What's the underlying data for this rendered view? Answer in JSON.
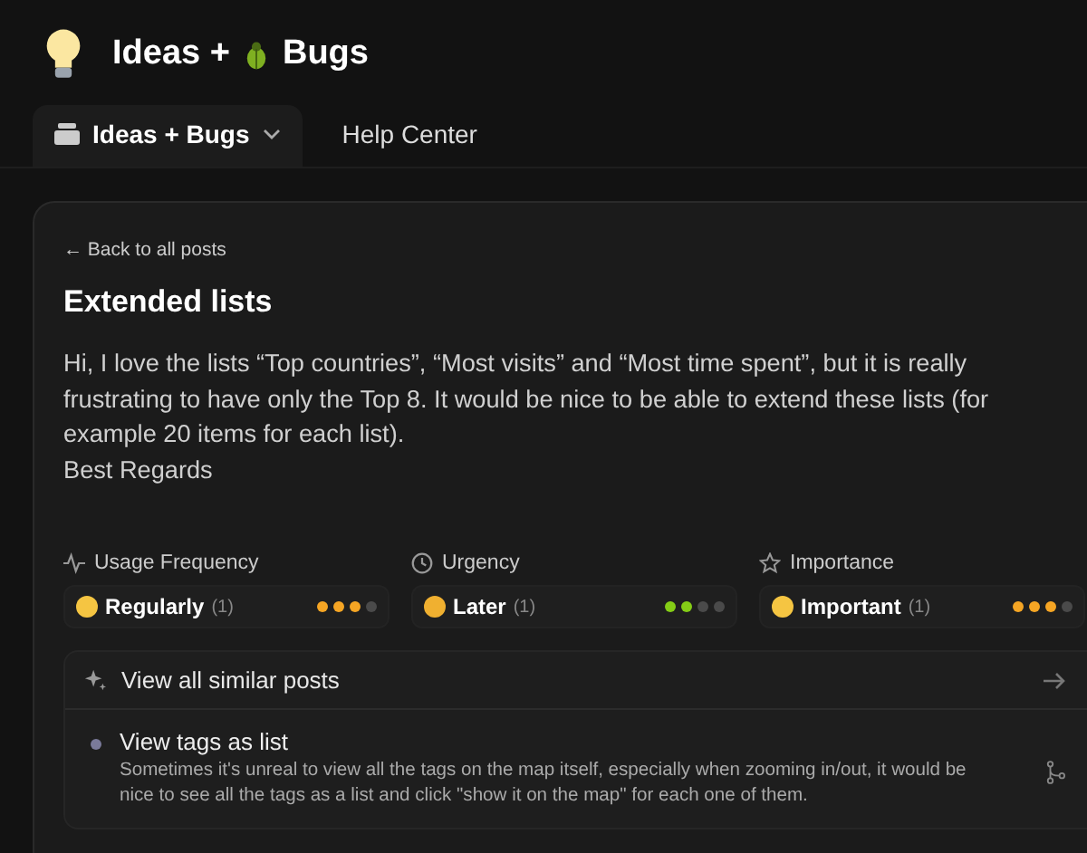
{
  "header": {
    "title_left": "Ideas +",
    "title_right": "Bugs"
  },
  "tabs": [
    {
      "label": "Ideas + Bugs",
      "selected": true,
      "dropdown": true
    },
    {
      "label": "Help Center",
      "selected": false,
      "dropdown": false
    }
  ],
  "post": {
    "back_link": "← Back to all posts",
    "title": "Extended lists",
    "body": [
      "Hi, I love the lists “Top countries”, “Most visits” and “Most time spent”, but it is really frustrating to have only the Top 8. It would be nice to be able to extend these lists (for example 20 items for each list).",
      "Best Regards"
    ]
  },
  "metrics": [
    {
      "kind": "frequency",
      "label": "Usage Frequency",
      "value": "Regularly",
      "count": "(1)",
      "level": 0.75,
      "color": "#f5a524"
    },
    {
      "kind": "urgency",
      "label": "Urgency",
      "value": "Later",
      "count": "(1)",
      "level": 0.5,
      "color": "#84cc16"
    },
    {
      "kind": "importance",
      "label": "Importance",
      "value": "Important",
      "count": "(1)",
      "level": 0.75,
      "color": "#f5a524"
    }
  ],
  "similar": {
    "title": "View all similar posts",
    "items": [
      {
        "title": "View tags as list",
        "description": "Sometimes it's unreal to view all the tags on the map itself, especially when zooming in/out, it would be nice to see all the tags as a list and click \"show it on the map\" for each one of them."
      }
    ]
  }
}
